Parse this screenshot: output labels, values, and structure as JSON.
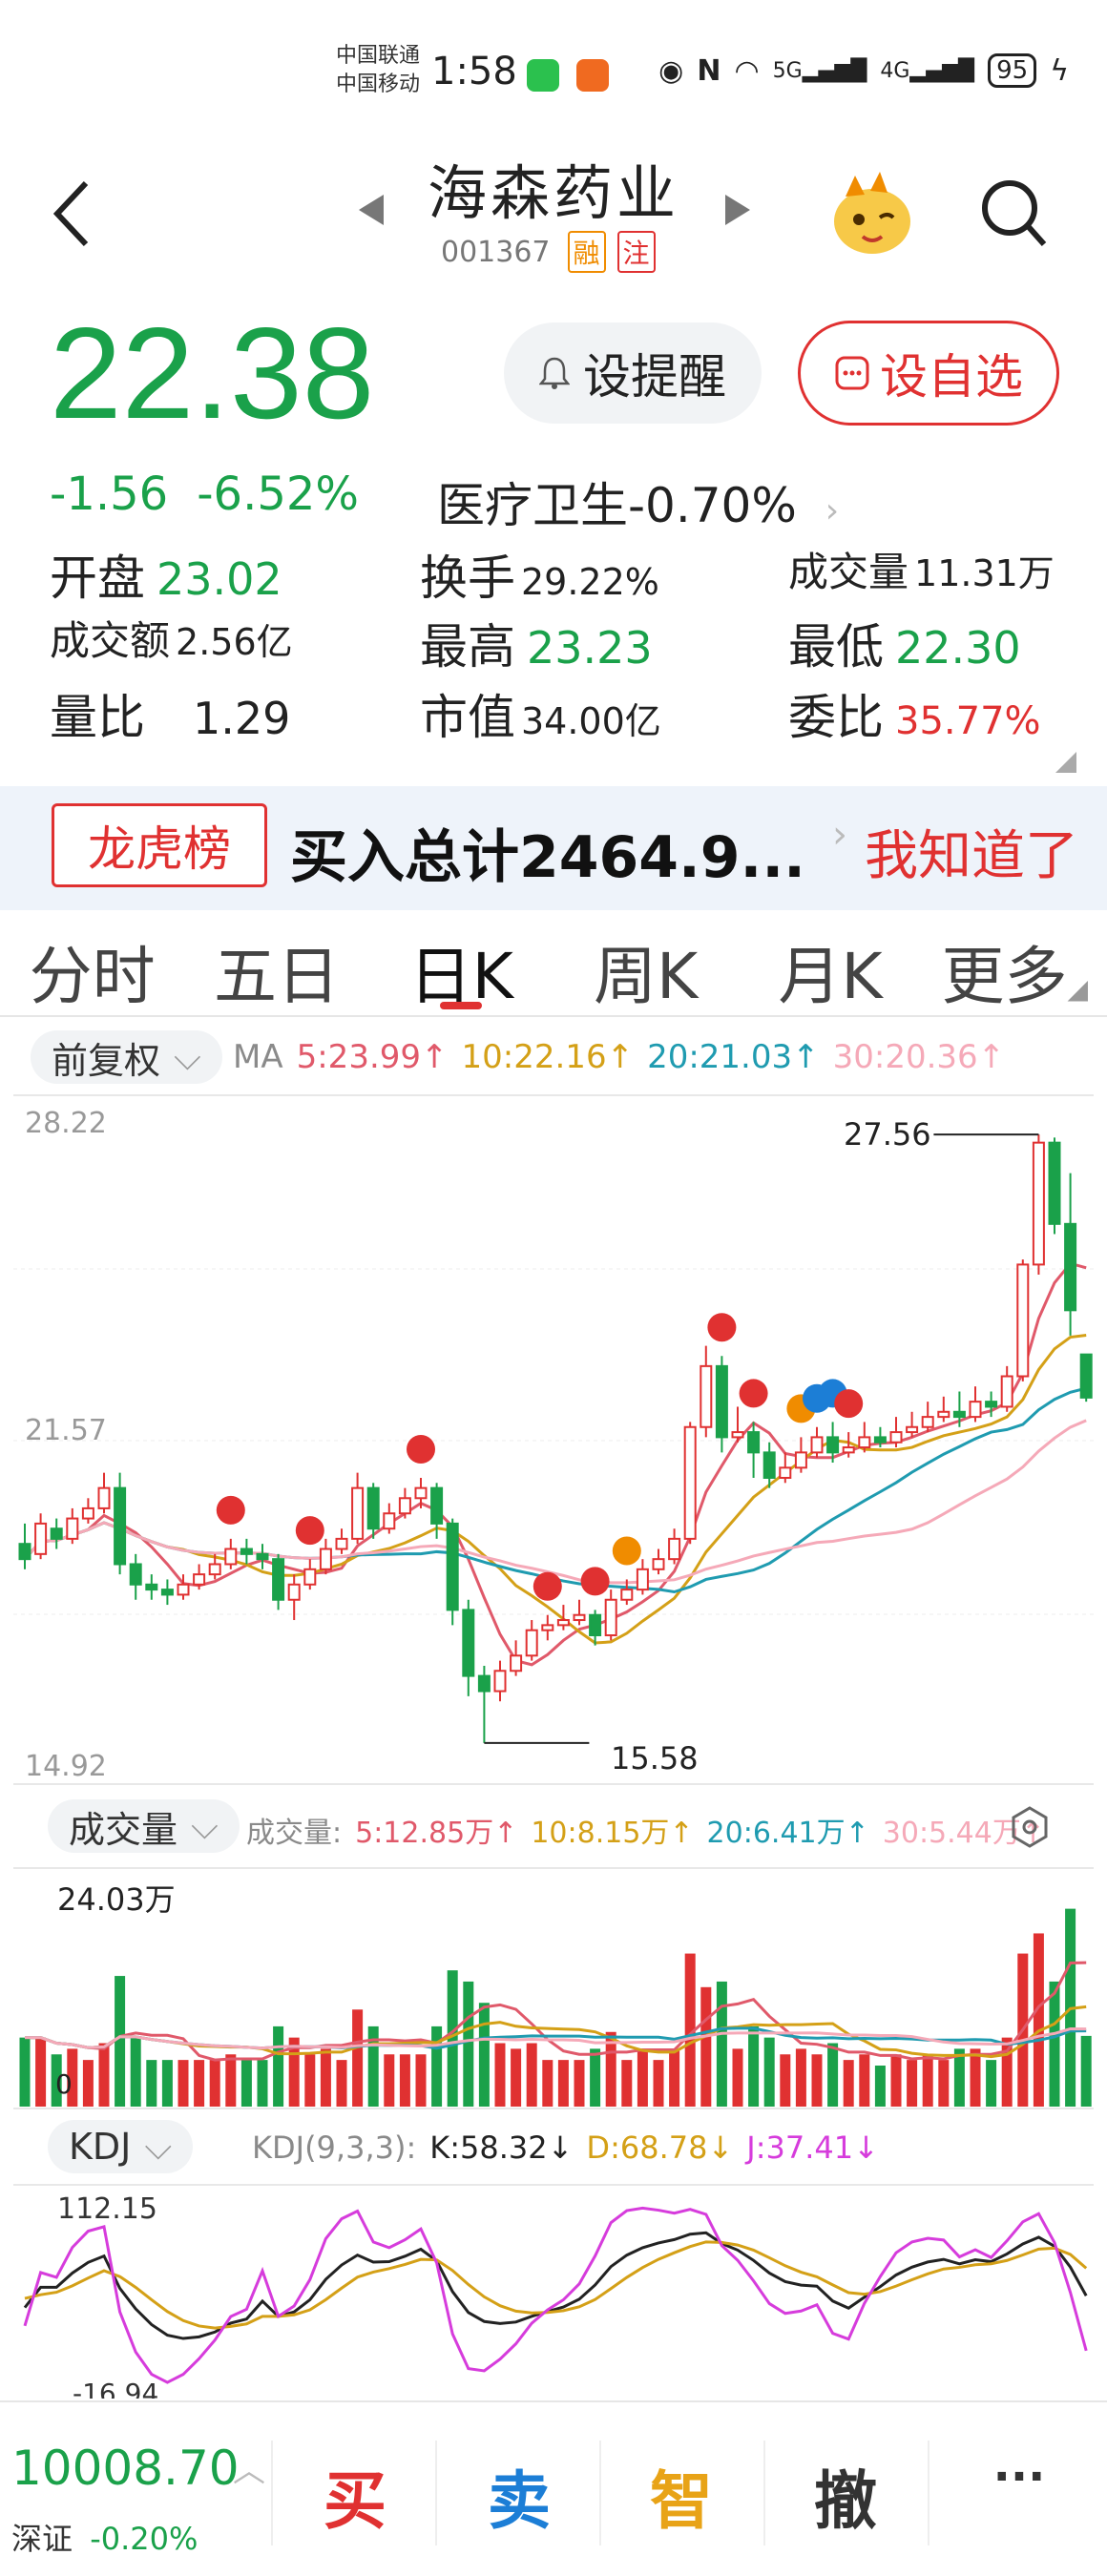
{
  "status_bar": {
    "carrier_1": "中国联通",
    "carrier_2": "中国移动",
    "time": "1:58",
    "battery": "95",
    "net_5g": "5G",
    "net_4g": "4G"
  },
  "header": {
    "stock_name": "海森药业",
    "stock_code": "001367",
    "tag_margin": "融",
    "tag_note": "注"
  },
  "quote": {
    "price": "22.38",
    "change": "-1.56",
    "change_pct": "-6.52%",
    "sector": "医疗卫生-0.70%",
    "alert_label": "设提醒",
    "fav_label": "设自选",
    "open_label": "开盘",
    "open_value": "23.02",
    "turnover_label": "换手",
    "turnover_value": "29.22%",
    "volume_label": "成交量",
    "volume_value": "11.31万",
    "amount_label": "成交额",
    "amount_value": "2.56亿",
    "high_label": "最高",
    "high_value": "23.23",
    "low_label": "最低",
    "low_value": "22.30",
    "ratio_label": "量比",
    "ratio_value": "1.29",
    "mcap_label": "市值",
    "mcap_value": "34.00亿",
    "committee_label": "委比",
    "committee_value": "35.77%"
  },
  "banner": {
    "tag": "龙虎榜",
    "text": "买入总计2464.9...",
    "dismiss": "我知道了"
  },
  "tabs": [
    {
      "label": "分时"
    },
    {
      "label": "五日"
    },
    {
      "label": "日K"
    },
    {
      "label": "周K"
    },
    {
      "label": "月K"
    },
    {
      "label": "更多"
    }
  ],
  "kline_panel": {
    "adjust_label": "前复权",
    "ma_title": "MA",
    "ma5": "5:23.99↑",
    "ma10": "10:22.16↑",
    "ma20": "20:21.03↑",
    "ma30": "30:20.36↑",
    "axis_top": "28.22",
    "axis_mid": "21.57",
    "axis_bottom": "14.92",
    "max_label": "27.56",
    "min_label": "15.58",
    "colors": {
      "ma5": "#e0596a",
      "ma10": "#d4a017",
      "ma20": "#1f9bb0",
      "ma30": "#f5a9b8",
      "up": "#e03131",
      "down": "#1aa14a"
    }
  },
  "volume_panel": {
    "label": "成交量",
    "legend_title": "成交量:",
    "v5": "5:12.85万↑",
    "v10": "10:8.15万↑",
    "v20": "20:6.41万↑",
    "v30": "30:5.44万↑",
    "axis_top": "24.03万",
    "axis_zero": "0"
  },
  "kdj_panel": {
    "label": "KDJ",
    "legend_title": "KDJ(9,3,3):",
    "k": "K:58.32↓",
    "d": "D:68.78↓",
    "j": "J:37.41↓",
    "axis_top": "112.15",
    "axis_bottom": "-16.94"
  },
  "bottom_bar": {
    "index_value": "10008.70",
    "index_name": "深证",
    "index_change": "-0.20%",
    "buy": "买",
    "sell": "卖",
    "smart": "智",
    "cancel": "撤",
    "more": "···"
  },
  "chart_data": {
    "type": "candlestick",
    "series": [
      {
        "name": "K",
        "values": [
          [
            19.5,
            19.2,
            19.9,
            19.0
          ],
          [
            19.3,
            19.9,
            20.1,
            19.2
          ],
          [
            19.8,
            19.6,
            20.0,
            19.4
          ],
          [
            19.6,
            20.0,
            20.2,
            19.5
          ],
          [
            20.0,
            20.2,
            20.4,
            19.9
          ],
          [
            20.2,
            20.6,
            20.9,
            20.1
          ],
          [
            20.6,
            19.1,
            20.9,
            18.9
          ],
          [
            19.1,
            18.7,
            19.3,
            18.4
          ],
          [
            18.7,
            18.6,
            18.9,
            18.4
          ],
          [
            18.6,
            18.5,
            18.8,
            18.3
          ],
          [
            18.5,
            18.7,
            18.9,
            18.4
          ],
          [
            18.7,
            18.9,
            19.1,
            18.6
          ],
          [
            18.9,
            19.1,
            19.3,
            18.8
          ],
          [
            19.1,
            19.4,
            19.6,
            19.0
          ],
          [
            19.4,
            19.3,
            19.6,
            19.1
          ],
          [
            19.3,
            19.2,
            19.5,
            19.0
          ],
          [
            19.2,
            18.4,
            19.3,
            18.2
          ],
          [
            18.4,
            18.7,
            18.9,
            18.0
          ],
          [
            18.7,
            19.0,
            19.2,
            18.6
          ],
          [
            19.0,
            19.4,
            19.6,
            18.9
          ],
          [
            19.4,
            19.6,
            19.8,
            19.3
          ],
          [
            19.6,
            20.6,
            20.9,
            19.5
          ],
          [
            20.6,
            19.8,
            20.7,
            19.6
          ],
          [
            19.8,
            20.1,
            20.3,
            19.7
          ],
          [
            20.1,
            20.4,
            20.6,
            20.0
          ],
          [
            20.4,
            20.6,
            20.8,
            20.2
          ],
          [
            20.6,
            19.9,
            20.7,
            19.6
          ],
          [
            19.9,
            18.2,
            20.0,
            17.9
          ],
          [
            18.2,
            16.9,
            18.4,
            16.5
          ],
          [
            16.9,
            16.6,
            17.1,
            15.58
          ],
          [
            16.6,
            17.0,
            17.2,
            16.4
          ],
          [
            17.0,
            17.3,
            17.6,
            16.9
          ],
          [
            17.3,
            17.8,
            18.0,
            17.2
          ],
          [
            17.8,
            17.9,
            18.1,
            17.6
          ],
          [
            17.9,
            18.0,
            18.3,
            17.8
          ],
          [
            18.0,
            18.1,
            18.4,
            17.9
          ],
          [
            18.1,
            17.7,
            18.2,
            17.5
          ],
          [
            17.7,
            18.4,
            18.6,
            17.6
          ],
          [
            18.4,
            18.6,
            18.8,
            18.3
          ],
          [
            18.6,
            19.0,
            19.2,
            18.5
          ],
          [
            19.0,
            19.2,
            19.4,
            18.9
          ],
          [
            19.2,
            19.6,
            19.8,
            19.1
          ],
          [
            19.6,
            21.8,
            21.9,
            19.5
          ],
          [
            21.8,
            23.0,
            23.4,
            21.6
          ],
          [
            23.0,
            21.6,
            23.2,
            21.3
          ],
          [
            21.6,
            21.7,
            22.2,
            21.5
          ],
          [
            21.7,
            21.3,
            21.9,
            20.8
          ],
          [
            21.3,
            20.8,
            21.5,
            20.6
          ],
          [
            20.8,
            21.0,
            21.3,
            20.7
          ],
          [
            21.0,
            21.3,
            21.6,
            20.9
          ],
          [
            21.3,
            21.6,
            21.8,
            21.2
          ],
          [
            21.6,
            21.3,
            21.9,
            21.1
          ],
          [
            21.3,
            21.4,
            21.7,
            21.2
          ],
          [
            21.4,
            21.6,
            21.9,
            21.3
          ],
          [
            21.6,
            21.5,
            21.8,
            21.4
          ],
          [
            21.5,
            21.7,
            22.0,
            21.4
          ],
          [
            21.7,
            21.8,
            22.1,
            21.6
          ],
          [
            21.8,
            22.0,
            22.3,
            21.7
          ],
          [
            22.0,
            22.1,
            22.4,
            21.9
          ],
          [
            22.1,
            22.0,
            22.5,
            21.8
          ],
          [
            22.0,
            22.3,
            22.6,
            21.9
          ],
          [
            22.3,
            22.2,
            22.5,
            22.0
          ],
          [
            22.2,
            22.8,
            23.0,
            22.1
          ],
          [
            22.8,
            25.0,
            25.1,
            22.7
          ],
          [
            25.0,
            27.4,
            27.56,
            24.8
          ],
          [
            27.4,
            25.8,
            27.5,
            25.6
          ],
          [
            25.8,
            24.1,
            26.8,
            23.6
          ],
          [
            23.23,
            22.38,
            23.23,
            22.3
          ]
        ]
      }
    ],
    "ma_lines": [
      "MA5",
      "MA10",
      "MA20",
      "MA30"
    ],
    "ylim": [
      14.92,
      28.22
    ]
  }
}
